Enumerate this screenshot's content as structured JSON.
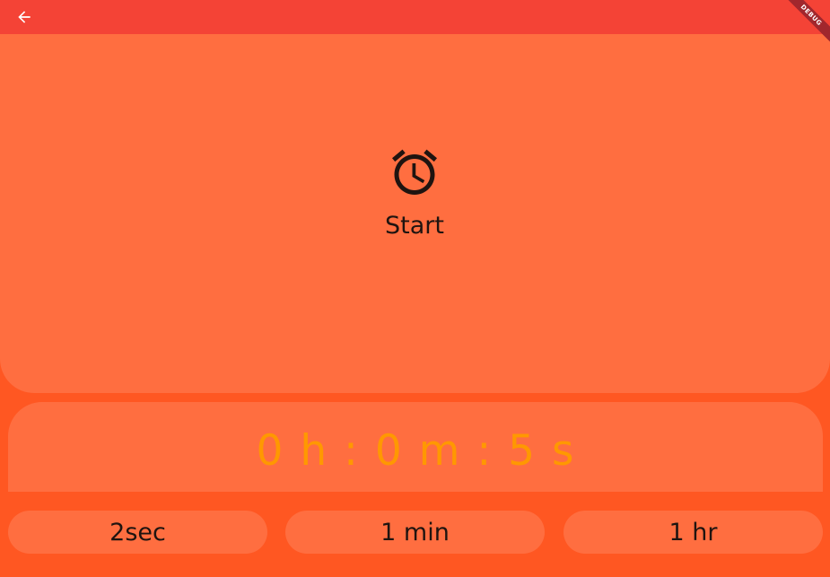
{
  "colors": {
    "appbar": "#F44336",
    "background": "#FF5722",
    "panel": "#FF6E40",
    "time_text": "#FF9800",
    "debug_banner": "#A1272D"
  },
  "appbar": {
    "back_icon": "arrow-back-icon",
    "debug_label": "DEBUG"
  },
  "start": {
    "icon": "alarm-icon",
    "label": "Start"
  },
  "timer": {
    "display": "0 h : 0 m : 5 s"
  },
  "presets": [
    {
      "label": "2sec"
    },
    {
      "label": "1 min"
    },
    {
      "label": "1 hr"
    }
  ]
}
